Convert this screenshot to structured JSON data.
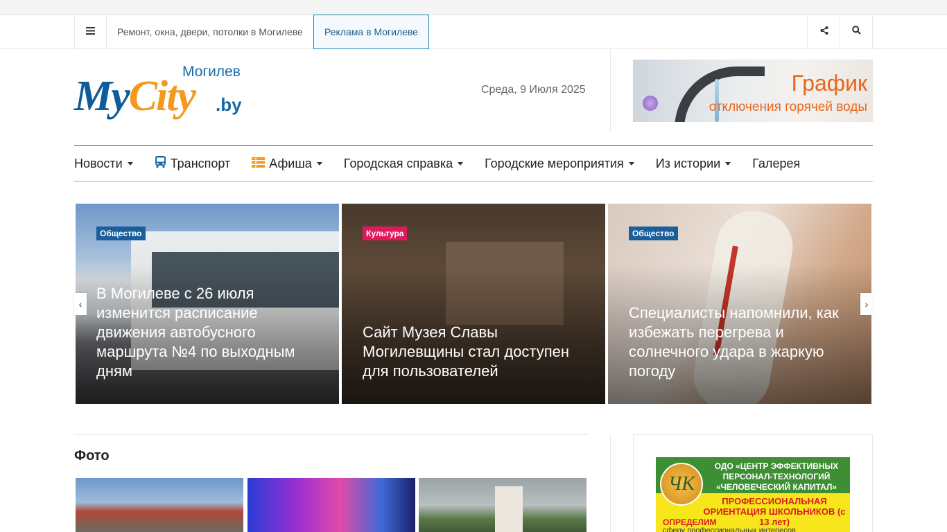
{
  "topbar": {
    "link1": "Ремонт, окна, двери, потолки в Могилеве",
    "link2": "Реклама в Могилеве",
    "menu_icon": "menu-icon",
    "share_icon": "share-icon",
    "search_icon": "search-icon"
  },
  "logo": {
    "city": "Могилев",
    "my": "My",
    "city_word": "City",
    "by": ".by"
  },
  "header": {
    "date": "Среда, 9 Июля 2025"
  },
  "banner_top": {
    "title": "График",
    "subtitle": "отключения горячей воды"
  },
  "nav": {
    "items": [
      {
        "label": "Новости",
        "dropdown": true
      },
      {
        "label": "Транспорт",
        "icon": "bus-icon"
      },
      {
        "label": "Афиша",
        "icon": "ticket-icon",
        "dropdown": true
      },
      {
        "label": "Городская справка",
        "dropdown": true
      },
      {
        "label": "Городские мероприятия",
        "dropdown": true
      },
      {
        "label": "Из истории",
        "dropdown": true
      },
      {
        "label": "Галерея"
      }
    ]
  },
  "slider": {
    "cards": [
      {
        "category": "Общество",
        "category_color": "#1a5f9c",
        "title": "В Могилеве с 26 июля изменится расписание движения автобусного маршрута №4 по выходным дням"
      },
      {
        "category": "Культура",
        "category_color": "#e0195f",
        "title": "Сайт Музея Славы Могилевщины стал доступен для пользователей"
      },
      {
        "category": "Общество",
        "category_color": "#1a5f9c",
        "title": "Специалисты напомнили, как избежать перегрева и солнечного удара в жаркую погоду"
      }
    ],
    "prev": "‹",
    "next": "›"
  },
  "foto": {
    "title": "Фото"
  },
  "ad_side": {
    "line1": "ОДО «ЦЕНТР ЭФФЕКТИВНЫХ ПЕРСОНАЛ-ТЕХНОЛОГИЙ «ЧЕЛОВЕЧЕСКИЙ КАПИТАЛ»",
    "logo_text": "ЧК",
    "line2": "ПРОФЕССИОНАЛЬНАЯ ОРИЕНТАЦИЯ ШКОЛЬНИКОВ (с 13 лет)",
    "line3": "ОПРЕДЕЛИМ",
    "line4": "сферу профессиональных интересов"
  }
}
